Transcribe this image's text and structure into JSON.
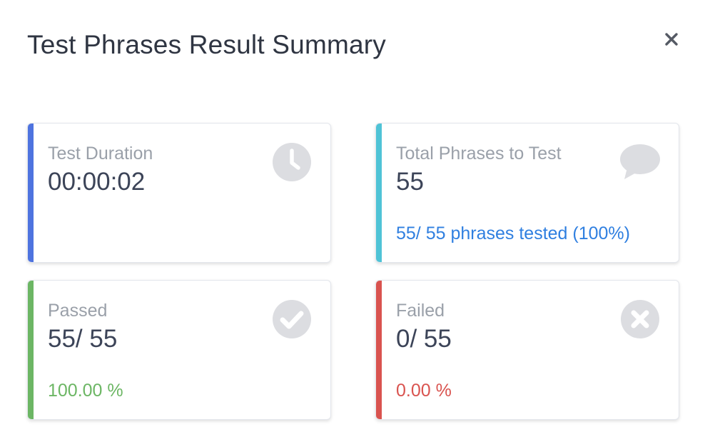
{
  "modal": {
    "title": "Test Phrases Result Summary",
    "close_icon": "close-icon"
  },
  "cards": {
    "duration": {
      "label": "Test Duration",
      "value": "00:00:02",
      "icon": "clock-icon",
      "accent": "#4e73df"
    },
    "total": {
      "label": "Total Phrases to Test",
      "value": "55",
      "footer": "55/ 55 phrases tested (100%)",
      "icon": "speech-bubble-icon",
      "accent": "#4fc3d6",
      "footer_color": "#2f7fe0"
    },
    "passed": {
      "label": "Passed",
      "value": "55/ 55",
      "footer": "100.00 %",
      "icon": "check-circle-icon",
      "accent": "#6cb664",
      "footer_color": "#6cb664"
    },
    "failed": {
      "label": "Failed",
      "value": "0/ 55",
      "footer": "0.00 %",
      "icon": "x-circle-icon",
      "accent": "#d9534f",
      "footer_color": "#d9534f"
    }
  },
  "colors": {
    "icon_gray": "#dcdde1",
    "label_gray": "#9aa0a9",
    "value_text": "#3c4458",
    "title_text": "#2f3542"
  }
}
